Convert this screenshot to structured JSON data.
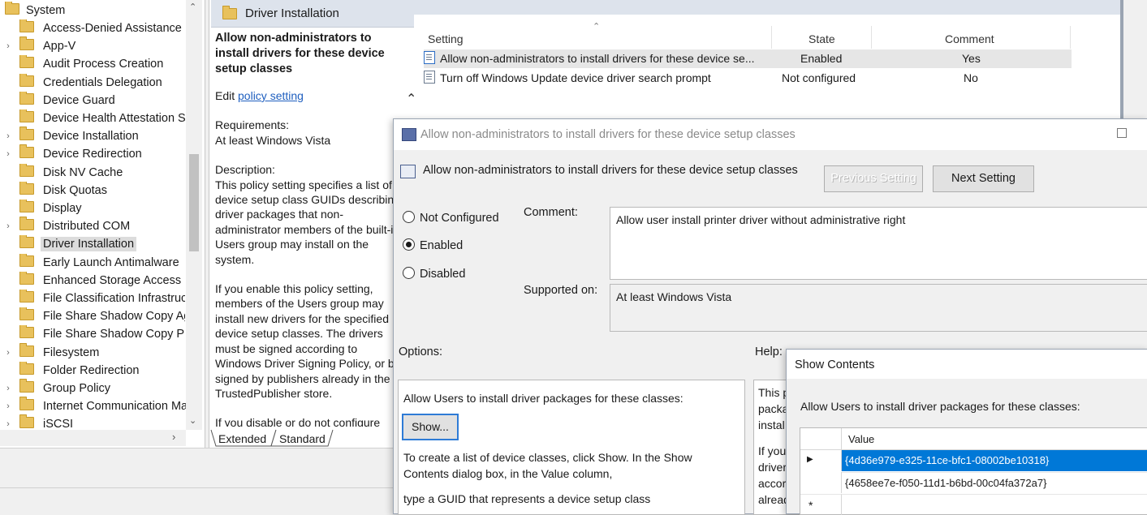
{
  "tree": {
    "root": "System",
    "items": [
      {
        "label": "Access-Denied Assistance",
        "expandable": false
      },
      {
        "label": "App-V",
        "expandable": true
      },
      {
        "label": "Audit Process Creation",
        "expandable": false
      },
      {
        "label": "Credentials Delegation",
        "expandable": false
      },
      {
        "label": "Device Guard",
        "expandable": false
      },
      {
        "label": "Device Health Attestation Se",
        "expandable": false
      },
      {
        "label": "Device Installation",
        "expandable": true
      },
      {
        "label": "Device Redirection",
        "expandable": true
      },
      {
        "label": "Disk NV Cache",
        "expandable": false
      },
      {
        "label": "Disk Quotas",
        "expandable": false
      },
      {
        "label": "Display",
        "expandable": false
      },
      {
        "label": "Distributed COM",
        "expandable": true
      },
      {
        "label": "Driver Installation",
        "expandable": false,
        "selected": true
      },
      {
        "label": "Early Launch Antimalware",
        "expandable": false
      },
      {
        "label": "Enhanced Storage Access",
        "expandable": false
      },
      {
        "label": "File Classification Infrastruct",
        "expandable": false
      },
      {
        "label": "File Share Shadow Copy Age",
        "expandable": false
      },
      {
        "label": "File Share Shadow Copy Pro",
        "expandable": false
      },
      {
        "label": "Filesystem",
        "expandable": true
      },
      {
        "label": "Folder Redirection",
        "expandable": false
      },
      {
        "label": "Group Policy",
        "expandable": true
      },
      {
        "label": "Internet Communication Ma",
        "expandable": true
      },
      {
        "label": "iSCSI",
        "expandable": true
      }
    ]
  },
  "detail": {
    "header": "Driver Installation",
    "policy_title": "Allow non-administrators to install drivers for these device setup classes",
    "edit_prefix": "Edit ",
    "edit_link": "policy setting",
    "requirements_label": "Requirements:",
    "requirements_value": "At least Windows Vista",
    "description_label": "Description:",
    "description_p1": "This policy setting specifies a list of device setup class GUIDs describing driver packages that non-administrator members of the built-in Users group may install on the system.",
    "description_p2": "If you enable this policy setting, members of the Users group may install new drivers for the specified device setup classes. The drivers must be signed according to Windows Driver Signing Policy, or be signed by publishers already in the TrustedPublisher store.",
    "description_p3": "If you disable or do not configure",
    "tabs": [
      "Extended",
      "Standard"
    ]
  },
  "list": {
    "columns": [
      "Setting",
      "State",
      "Comment"
    ],
    "rows": [
      {
        "setting": "Allow non-administrators to install drivers for these device se...",
        "state": "Enabled",
        "comment": "Yes"
      },
      {
        "setting": "Turn off Windows Update device driver search prompt",
        "state": "Not configured",
        "comment": "No"
      }
    ]
  },
  "dialog": {
    "title": "Allow non-administrators to install drivers for these device setup classes",
    "heading": "Allow non-administrators to install drivers for these device setup classes",
    "prev_button": "Previous Setting",
    "next_button": "Next Setting",
    "radios": [
      "Not Configured",
      "Enabled",
      "Disabled"
    ],
    "selected_radio": "Enabled",
    "comment_label": "Comment:",
    "comment_value": "Allow user install printer driver without administrative right",
    "supported_label": "Supported on:",
    "supported_value": "At least Windows Vista",
    "options_label": "Options:",
    "help_label": "Help:",
    "options_text": "Allow Users to install driver packages for these classes:",
    "show_button": "Show...",
    "options_help1": "To create a list of device classes, click Show. In the Show Contents dialog box, in the Value column,",
    "options_help2": "type a GUID that represents a device setup class",
    "help_fragments": [
      "This p",
      "packa",
      "instal",
      "If you",
      "driver",
      "accor",
      "alread"
    ]
  },
  "show_contents": {
    "title": "Show Contents",
    "label": "Allow Users to install driver packages for these classes:",
    "column": "Value",
    "rows": [
      "{4d36e979-e325-11ce-bfc1-08002be10318}",
      "{4658ee7e-f050-11d1-b6bd-00c04fa372a7}"
    ],
    "new_row_marker": "*"
  },
  "colors": {
    "selection_blue": "#0078d7",
    "header_bg": "#dde3ec",
    "link": "#1f5fbf"
  }
}
